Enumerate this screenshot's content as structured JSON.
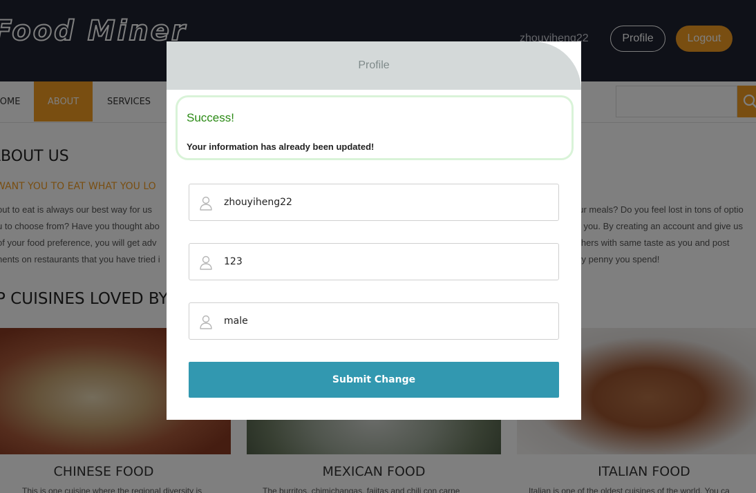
{
  "header": {
    "logo": "Food Miner",
    "username": "zhouyiheng22",
    "profile_label": "Profile",
    "logout_label": "Logout"
  },
  "nav": {
    "items": [
      {
        "label": "HOME"
      },
      {
        "label": "ABOUT"
      },
      {
        "label": "SERVICES"
      }
    ]
  },
  "about": {
    "title": "ABOUT US",
    "subtitle": "WANT YOU TO EAT WHAT YOU LO",
    "left_lines": [
      "out to eat is always our best way for us",
      "u to choose from? Have you thought abo",
      "of your food preference, you will get adv",
      "nents on restaurants that you have tried i"
    ],
    "right_lines": [
      "our meals? Do you feel lost in tons of optio",
      "to you. By creating an account and give us",
      "others with same taste as you and post",
      "ery penny you spend!"
    ]
  },
  "cuisines": {
    "title": "P CUISINES LOVED BY",
    "items": [
      {
        "name": "CHINESE FOOD",
        "desc": "This is one cuisine where the regional diversity is"
      },
      {
        "name": "MEXICAN FOOD",
        "desc": "The burritos, chimichangas, fajitas and chili con carne"
      },
      {
        "name": "ITALIAN FOOD",
        "desc": "Italian is one of the oldest cuisines of the world. You ca"
      }
    ]
  },
  "modal": {
    "title": "Profile",
    "alert": {
      "title": "Success!",
      "message": "Your information has already been updated!"
    },
    "fields": [
      {
        "value": "zhouyiheng22",
        "icon": "user-icon"
      },
      {
        "value": "123",
        "icon": "user-icon"
      },
      {
        "value": "male",
        "icon": "user-icon"
      }
    ],
    "submit_label": "Submit Change"
  },
  "colors": {
    "accent": "#f29c22",
    "header_bg": "#1f2331",
    "submit": "#3298b0",
    "success_text": "#2a8a14",
    "success_border": "#d9f3d8",
    "modal_header": "#d4d9d9"
  }
}
